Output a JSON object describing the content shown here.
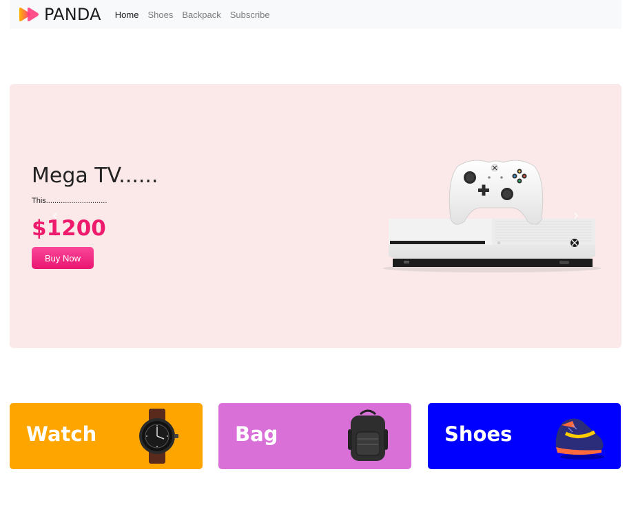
{
  "navbar": {
    "brand_text": "PANDA",
    "brand_logo_icon": "double-play-arrow-logo",
    "links": [
      {
        "label": "Home",
        "active": true
      },
      {
        "label": "Shoes",
        "active": false
      },
      {
        "label": "Backpack",
        "active": false
      },
      {
        "label": "Subscribe",
        "active": false
      }
    ]
  },
  "hero": {
    "title": "Mega TV......",
    "description": "This.............................",
    "price": "$1200",
    "buy_button": "Buy Now",
    "prev_icon": "chevron-left-icon",
    "next_icon": "chevron-right-icon",
    "product_image": "game-console-with-controller",
    "prev_glyph": "‹",
    "next_glyph": "›"
  },
  "categories": [
    {
      "label": "Watch",
      "image": "wrist-watch",
      "color": "#ffa500"
    },
    {
      "label": "Bag",
      "image": "backpack",
      "color": "#d870d8"
    },
    {
      "label": "Shoes",
      "image": "sneaker",
      "color": "#0000ff"
    }
  ],
  "colors": {
    "accent": "#ee1a6b",
    "hero_background": "#fbe8e8",
    "navbar_background": "#f8f9fa"
  }
}
